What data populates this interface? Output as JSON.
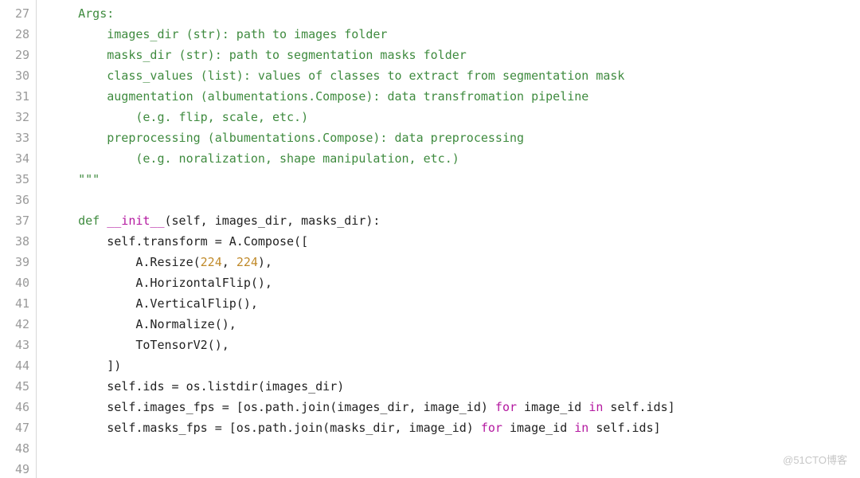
{
  "watermark": "@51CTO博客",
  "lines": [
    {
      "n": 27,
      "indent": "    ",
      "seg": [
        {
          "t": "Args:",
          "cls": "c"
        }
      ]
    },
    {
      "n": 28,
      "indent": "        ",
      "seg": [
        {
          "t": "images_dir (str): path to images folder",
          "cls": "c"
        }
      ]
    },
    {
      "n": 29,
      "indent": "        ",
      "seg": [
        {
          "t": "masks_dir (str): path to segmentation masks folder",
          "cls": "c"
        }
      ]
    },
    {
      "n": 30,
      "indent": "        ",
      "seg": [
        {
          "t": "class_values (list): values of classes to extract from segmentation mask",
          "cls": "c"
        }
      ]
    },
    {
      "n": 31,
      "indent": "        ",
      "seg": [
        {
          "t": "augmentation (albumentations.Compose): data transfromation pipeline",
          "cls": "c"
        }
      ]
    },
    {
      "n": 32,
      "indent": "            ",
      "seg": [
        {
          "t": "(e.g. flip, scale, etc.)",
          "cls": "c"
        }
      ]
    },
    {
      "n": 33,
      "indent": "        ",
      "seg": [
        {
          "t": "preprocessing (albumentations.Compose): data preprocessing",
          "cls": "c"
        }
      ]
    },
    {
      "n": 34,
      "indent": "            ",
      "seg": [
        {
          "t": "(e.g. noralization, shape manipulation, etc.)",
          "cls": "c"
        }
      ]
    },
    {
      "n": 35,
      "indent": "    ",
      "seg": [
        {
          "t": "\"\"\"",
          "cls": "c"
        }
      ]
    },
    {
      "n": 36,
      "indent": "",
      "seg": [
        {
          "t": "",
          "cls": ""
        }
      ]
    },
    {
      "n": 37,
      "indent": "    ",
      "seg": [
        {
          "t": "def",
          "cls": "k"
        },
        {
          "t": " ",
          "cls": ""
        },
        {
          "t": "__init__",
          "cls": "fn"
        },
        {
          "t": "(self, images_dir, masks_dir):",
          "cls": ""
        }
      ]
    },
    {
      "n": 38,
      "indent": "        ",
      "seg": [
        {
          "t": "self.transform = A.Compose([",
          "cls": ""
        }
      ]
    },
    {
      "n": 39,
      "indent": "            ",
      "seg": [
        {
          "t": "A.Resize(",
          "cls": ""
        },
        {
          "t": "224",
          "cls": "nm"
        },
        {
          "t": ", ",
          "cls": ""
        },
        {
          "t": "224",
          "cls": "nm"
        },
        {
          "t": "),",
          "cls": ""
        }
      ]
    },
    {
      "n": 40,
      "indent": "            ",
      "seg": [
        {
          "t": "A.HorizontalFlip(),",
          "cls": ""
        }
      ]
    },
    {
      "n": 41,
      "indent": "            ",
      "seg": [
        {
          "t": "A.VerticalFlip(),",
          "cls": ""
        }
      ]
    },
    {
      "n": 42,
      "indent": "            ",
      "seg": [
        {
          "t": "A.Normalize(),",
          "cls": ""
        }
      ]
    },
    {
      "n": 43,
      "indent": "            ",
      "seg": [
        {
          "t": "ToTensorV2(),",
          "cls": ""
        }
      ]
    },
    {
      "n": 44,
      "indent": "        ",
      "seg": [
        {
          "t": "])",
          "cls": ""
        }
      ]
    },
    {
      "n": 45,
      "indent": "        ",
      "seg": [
        {
          "t": "self.ids = os.listdir(images_dir)",
          "cls": ""
        }
      ]
    },
    {
      "n": 46,
      "indent": "        ",
      "seg": [
        {
          "t": "self.images_fps = [os.path.join(images_dir, image_id) ",
          "cls": ""
        },
        {
          "t": "for",
          "cls": "kw"
        },
        {
          "t": " image_id ",
          "cls": ""
        },
        {
          "t": "in",
          "cls": "kw"
        },
        {
          "t": " self.ids]",
          "cls": ""
        }
      ]
    },
    {
      "n": 47,
      "indent": "        ",
      "seg": [
        {
          "t": "self.masks_fps = [os.path.join(masks_dir, image_id) ",
          "cls": ""
        },
        {
          "t": "for",
          "cls": "kw"
        },
        {
          "t": " image_id ",
          "cls": ""
        },
        {
          "t": "in",
          "cls": "kw"
        },
        {
          "t": " self.ids]",
          "cls": ""
        }
      ]
    },
    {
      "n": 48,
      "indent": "",
      "seg": [
        {
          "t": "",
          "cls": ""
        }
      ]
    },
    {
      "n": 49,
      "indent": "",
      "seg": [
        {
          "t": "",
          "cls": ""
        }
      ]
    }
  ]
}
